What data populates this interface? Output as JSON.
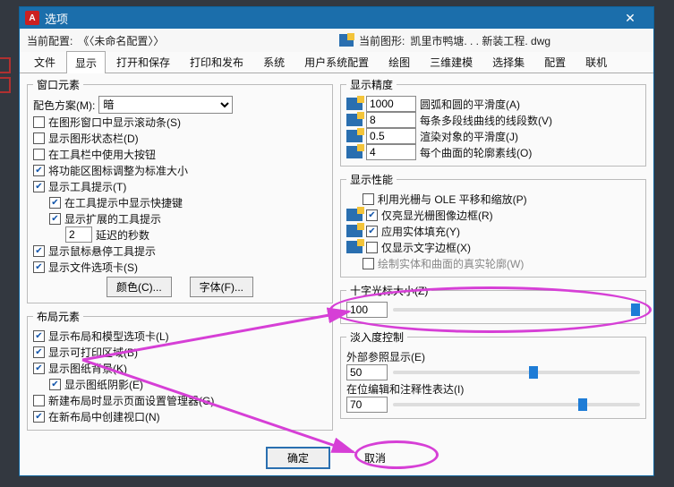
{
  "titlebar": {
    "text": "选项"
  },
  "inforow": {
    "profile_label": "当前配置:",
    "profile_value": "《〈未命名配置〉〉",
    "drawing_label": "当前图形:",
    "drawing_value": "凯里市鸭塘. . . 新装工程. dwg"
  },
  "tabs": [
    "文件",
    "显示",
    "打开和保存",
    "打印和发布",
    "系统",
    "用户系统配置",
    "绘图",
    "三维建模",
    "选择集",
    "配置",
    "联机"
  ],
  "active_tab_index": 1,
  "left": {
    "window_elements_legend": "窗口元素",
    "colorscheme_label": "配色方案(M):",
    "colorscheme_value": "暗",
    "scrollbars": "在图形窗口中显示滚动条(S)",
    "statusbar": "显示图形状态栏(D)",
    "largebuttons": "在工具栏中使用大按钮",
    "ribbonstd": "将功能区图标调整为标准大小",
    "tooltips": "显示工具提示(T)",
    "tooltips_shortcut": "在工具提示中显示快捷键",
    "ext_tooltips": "显示扩展的工具提示",
    "delay_seconds_label": "延迟的秒数",
    "delay_seconds_value": "2",
    "hover_tips": "显示鼠标悬停工具提示",
    "file_tabs": "显示文件选项卡(S)",
    "color_btn": "颜色(C)...",
    "font_btn": "字体(F)...",
    "layout_legend": "布局元素",
    "layout_model_tabs": "显示布局和模型选项卡(L)",
    "printable": "显示可打印区域(B)",
    "paperbg": "显示图纸背景(K)",
    "papershadow": "显示图纸阴影(E)",
    "pagesetupmgr": "新建布局时显示页面设置管理器(G)",
    "createvp": "在新布局中创建视口(N)"
  },
  "right": {
    "precision_legend": "显示精度",
    "arc_smooth_value": "1000",
    "arc_smooth_label": "圆弧和圆的平滑度(A)",
    "polyline_segs_value": "8",
    "polyline_segs_label": "每条多段线曲线的线段数(V)",
    "render_smooth_value": "0.5",
    "render_smooth_label": "渲染对象的平滑度(J)",
    "surface_contour_value": "4",
    "surface_contour_label": "每个曲面的轮廓素线(O)",
    "perf_legend": "显示性能",
    "pan_raster": "利用光栅与 OLE 平移和缩放(P)",
    "highlight_raster": "仅亮显光栅图像边框(R)",
    "solid_fill": "应用实体填充(Y)",
    "text_frame": "仅显示文字边框(X)",
    "true_silhouette": "绘制实体和曲面的真实轮廓(W)",
    "cross_legend": "十字光标大小(Z)",
    "cross_value": "100",
    "fade_legend": "淡入度控制",
    "xref_label": "外部参照显示(E)",
    "xref_value": "50",
    "inplace_label": "在位编辑和注释性表达(I)",
    "inplace_value": "70"
  },
  "footer": {
    "ok": "确定",
    "cancel": "取消"
  }
}
